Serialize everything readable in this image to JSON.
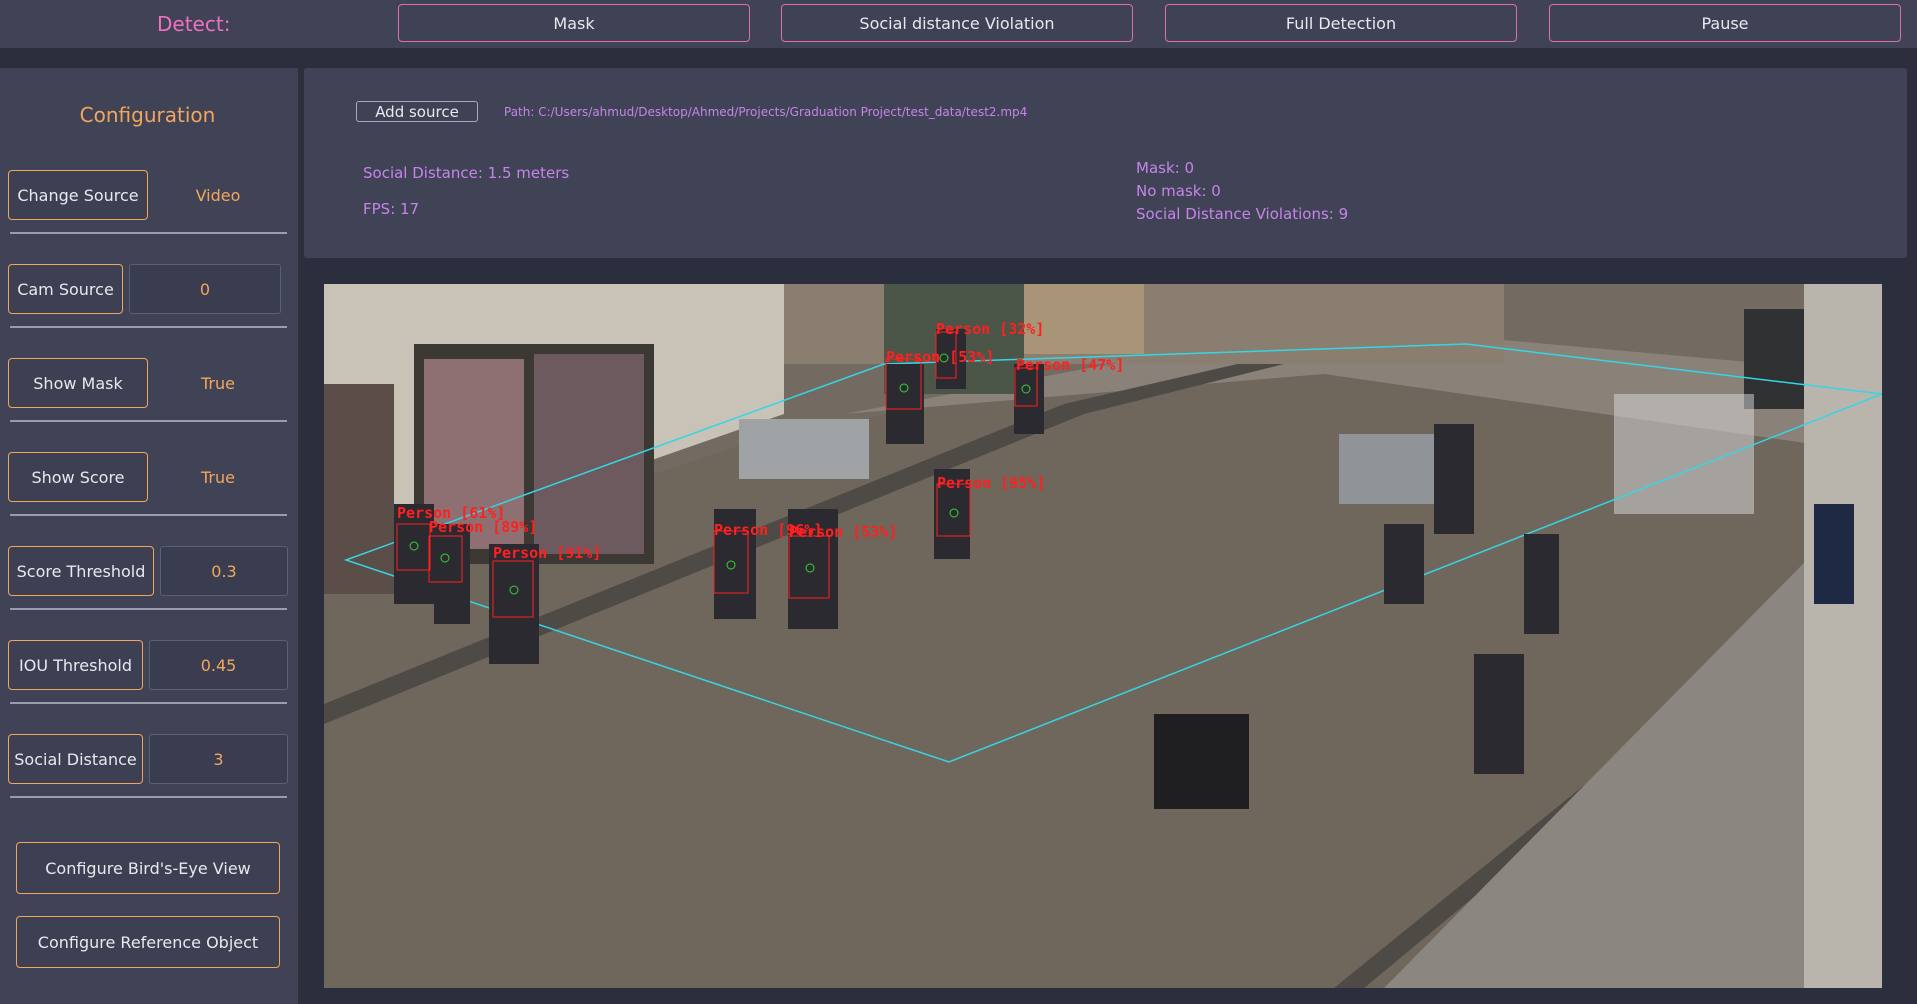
{
  "topbar": {
    "detect_label": "Detect:",
    "buttons": [
      "Mask",
      "Social distance Violation",
      "Full Detection",
      "Pause"
    ]
  },
  "sidebar": {
    "title": "Configuration",
    "rows": [
      {
        "label": "Change Source",
        "value": "Video"
      },
      {
        "label": "Cam Source",
        "value": "0"
      },
      {
        "label": "Show Mask",
        "value": "True"
      },
      {
        "label": "Show Score",
        "value": "True"
      },
      {
        "label": "Score Threshold",
        "value": "0.3"
      },
      {
        "label": "IOU Threshold",
        "value": "0.45"
      },
      {
        "label": "Social Distance",
        "value": "3"
      }
    ],
    "bird_eye_button": "Configure Bird's-Eye View",
    "reference_button": "Configure Reference Object"
  },
  "info": {
    "add_source_label": "Add source",
    "path": "Path: C:/Users/ahmud/Desktop/Ahmed/Projects/Graduation Project/test_data/test2.mp4",
    "social_distance": "Social Distance: 1.5 meters",
    "fps": "FPS: 17",
    "mask_count": "Mask: 0",
    "no_mask_count": "No mask: 0",
    "violations": "Social Distance Violations: 9"
  },
  "video": {
    "detections": [
      "Person [32%]",
      "Person [53%]",
      "Person [47%]",
      "Person [95%]",
      "Person [61%]",
      "Person [89%]",
      "Person [91%]",
      "Person [96%]",
      "Person [53%]"
    ]
  },
  "colors": {
    "accent_pink": "#f06fc2",
    "accent_orange": "#f2a65c",
    "stat_purple": "#c684e8",
    "detection_red": "#ff2020",
    "roi_cyan": "#34d6e6"
  }
}
